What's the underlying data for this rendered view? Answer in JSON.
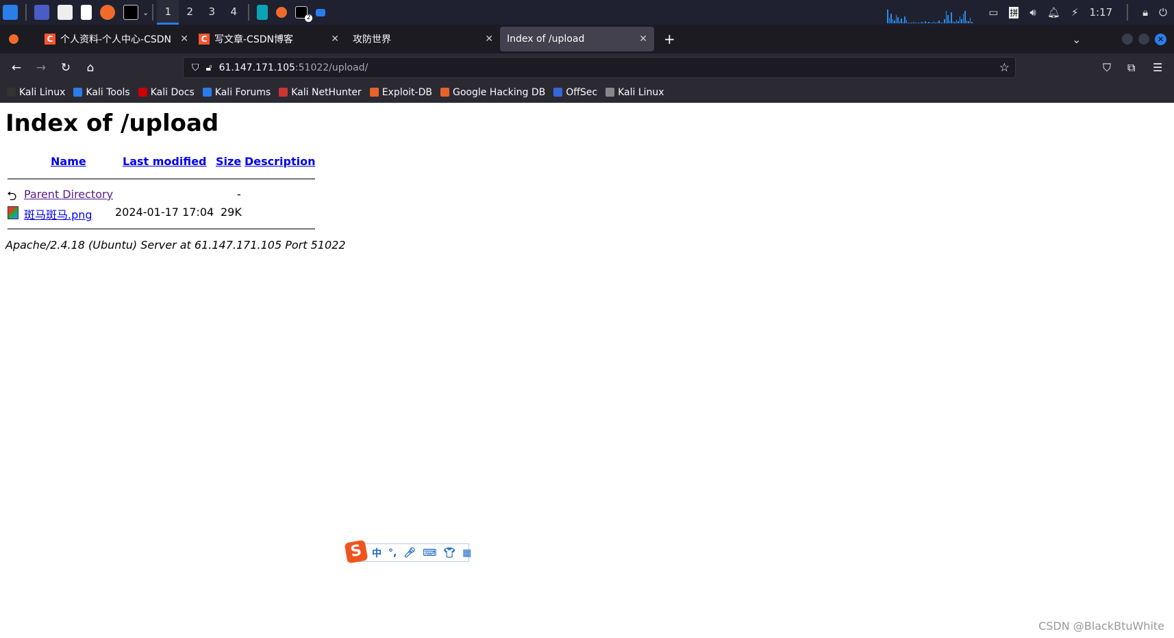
{
  "taskbar": {
    "workspaces": [
      "1",
      "2",
      "3",
      "4"
    ],
    "active_workspace": "1",
    "clock": "1:17",
    "ime_indicator": "拼",
    "badge": "2"
  },
  "browser": {
    "tabs": [
      {
        "label": "个人资料-个人中心-CSDN",
        "favicon": "C",
        "active": false
      },
      {
        "label": "写文章-CSDN博客",
        "favicon": "C",
        "active": false
      },
      {
        "label": "攻防世界",
        "active": false
      },
      {
        "label": "Index of /upload",
        "active": true
      }
    ],
    "new_tab": "+",
    "url_host": "61.147.171.105",
    "url_rest": ":51022/upload/",
    "bookmarks": [
      "Kali Linux",
      "Kali Tools",
      "Kali Docs",
      "Kali Forums",
      "Kali NetHunter",
      "Exploit-DB",
      "Google Hacking DB",
      "OffSec",
      "Kali Linux"
    ]
  },
  "page": {
    "title": "Index of /upload",
    "columns": [
      "Name",
      "Last modified",
      "Size",
      "Description"
    ],
    "rows": [
      {
        "name": "Parent Directory",
        "modified": "",
        "size": "-",
        "icon": "back-icon"
      },
      {
        "name": "斑马斑马.png",
        "modified": "2024-01-17 17:04",
        "size": "29K",
        "icon": "image-icon"
      }
    ],
    "address": "Apache/2.4.18 (Ubuntu) Server at 61.147.171.105 Port 51022"
  },
  "ime": {
    "logo": "S",
    "mode": "中",
    "punct": "°,"
  },
  "watermark": "CSDN @BlackBtuWhite",
  "colors": {
    "link": "#0000ee",
    "visited": "#551a8b",
    "accent": "#2b7de9"
  }
}
